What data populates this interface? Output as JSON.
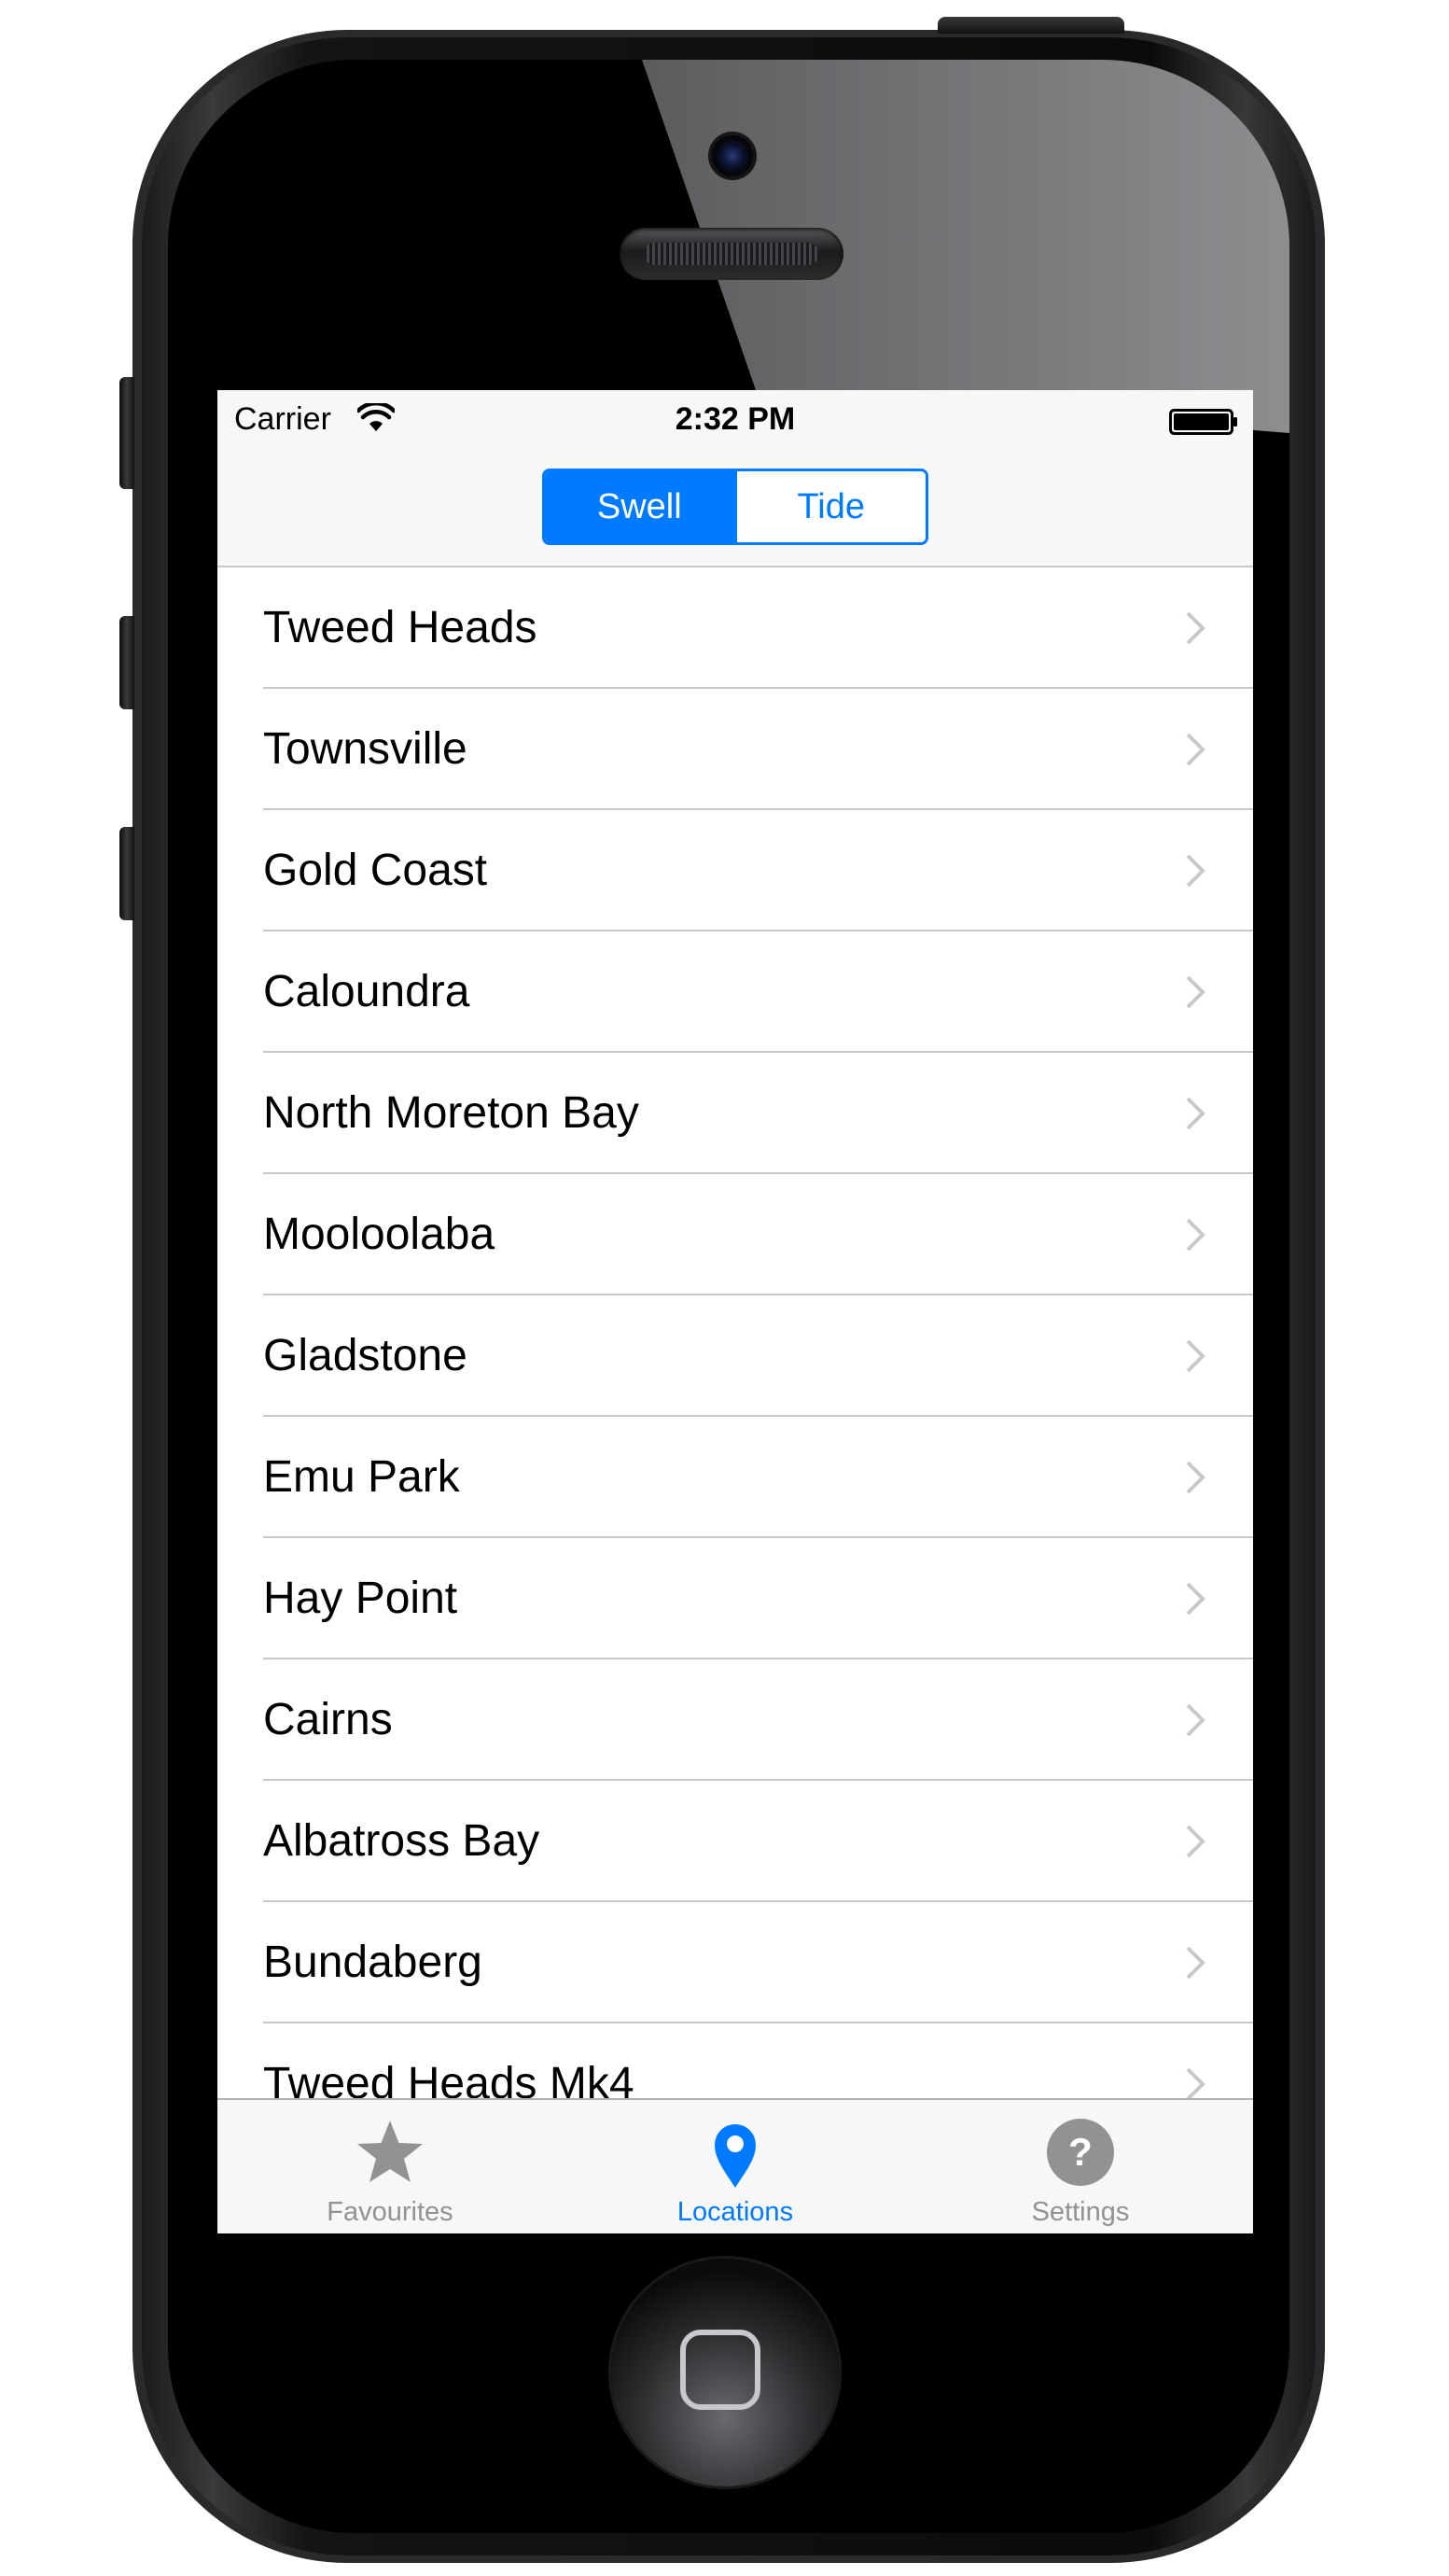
{
  "status_bar": {
    "carrier": "Carrier",
    "time": "2:32 PM"
  },
  "segmented_control": {
    "segments": [
      "Swell",
      "Tide"
    ],
    "selected": "Swell"
  },
  "locations": [
    "Tweed Heads",
    "Townsville",
    "Gold Coast",
    "Caloundra",
    "North Moreton Bay",
    "Mooloolaba",
    "Gladstone",
    "Emu Park",
    "Hay Point",
    "Cairns",
    "Albatross Bay",
    "Bundaberg",
    "Tweed Heads Mk4"
  ],
  "tab_bar": {
    "tabs": [
      {
        "label": "Favourites",
        "icon": "star-icon",
        "active": false
      },
      {
        "label": "Locations",
        "icon": "location-pin-icon",
        "active": true
      },
      {
        "label": "Settings",
        "icon": "question-mark-icon",
        "active": false
      }
    ]
  },
  "colors": {
    "accent": "#007aff",
    "inactive_tab": "#929292",
    "bar_background": "#f7f7f7",
    "separator": "#c8c7cc"
  }
}
